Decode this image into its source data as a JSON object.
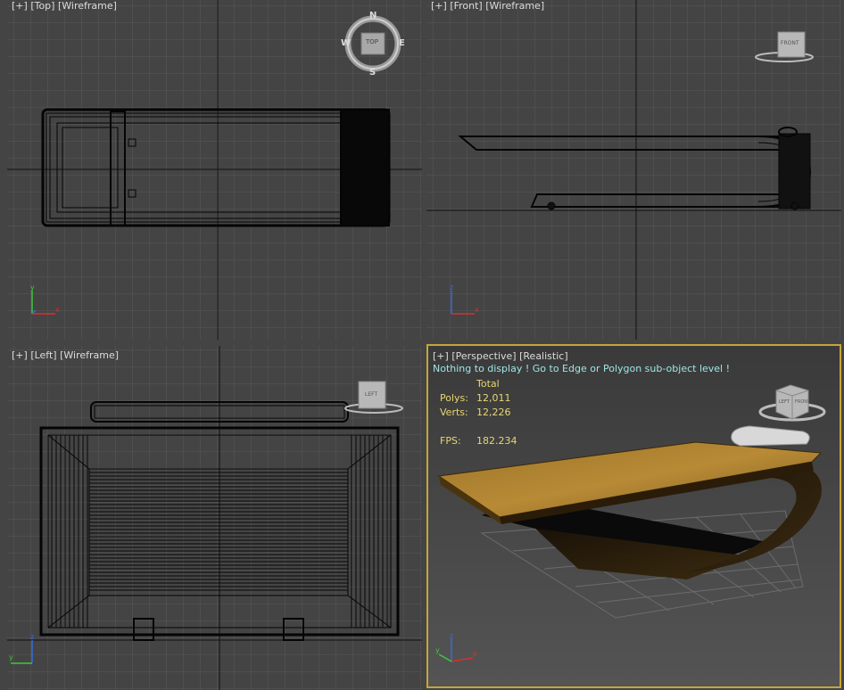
{
  "viewports": {
    "top": {
      "bracket_plus": "[+]",
      "view": "[Top]",
      "mode": "[Wireframe]",
      "cube_label": "TOP",
      "compass": {
        "n": "N",
        "s": "S",
        "e": "E",
        "w": "W"
      }
    },
    "front": {
      "bracket_plus": "[+]",
      "view": "[Front]",
      "mode": "[Wireframe]",
      "cube_label": "FRONT"
    },
    "left": {
      "bracket_plus": "[+]",
      "view": "[Left]",
      "mode": "[Wireframe]",
      "cube_label": "LEFT"
    },
    "perspective": {
      "bracket_plus": "[+]",
      "view": "[Perspective]",
      "mode": "[Realistic]",
      "message": "Nothing to display ! Go to Edge or Polygon sub-object level !",
      "stats": {
        "total_label": "Total",
        "polys_label": "Polys:",
        "polys": "12,011",
        "verts_label": "Verts:",
        "verts": "12,226",
        "fps_label": "FPS:",
        "fps": "182.234"
      },
      "cube_labels": {
        "left": "LEFT",
        "front": "FRONT"
      }
    }
  },
  "axis_labels": {
    "x": "x",
    "y": "y",
    "z": "z"
  },
  "colors": {
    "bg": "#444444",
    "grid": "#5a5a5a",
    "axis": "#1a1a1a",
    "active_border": "#c8a53a",
    "stats": "#e8d770",
    "message": "#9fe6e6"
  }
}
